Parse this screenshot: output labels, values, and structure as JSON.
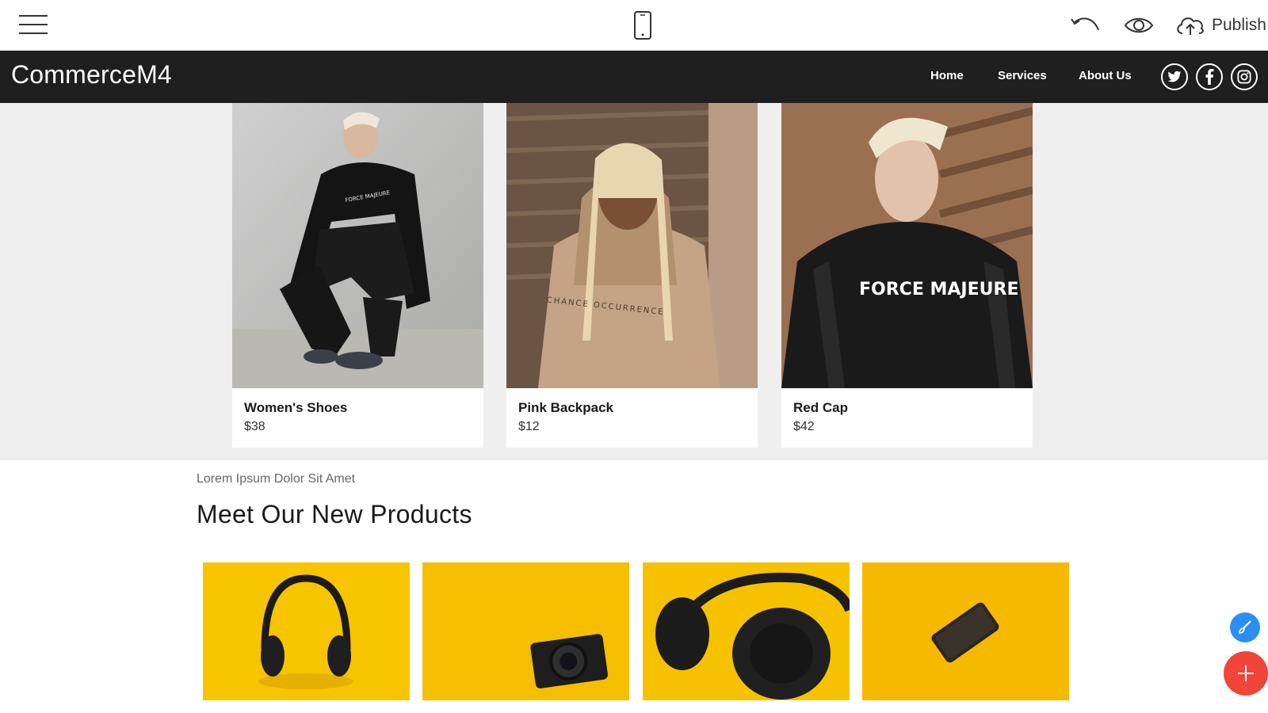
{
  "editor": {
    "menu_icon": "hamburger-icon",
    "device_icon": "mobile-phone-icon",
    "undo_icon": "undo-icon",
    "preview_icon": "eye-icon",
    "publish_icon": "cloud-upload-icon",
    "publish_label": "Publish"
  },
  "site": {
    "brand": "CommerceM4",
    "nav": [
      "Home",
      "Services",
      "About Us"
    ],
    "social": [
      "twitter-icon",
      "facebook-icon",
      "instagram-icon"
    ]
  },
  "featured": {
    "cards": [
      {
        "name": "Women's Shoes",
        "price": "$38"
      },
      {
        "name": "Pink Backpack",
        "price": "$12"
      },
      {
        "name": "Red Cap",
        "price": "$42"
      }
    ],
    "shirt_texts": [
      "FORCE MAJEURE",
      "CHANCE OCCURRENCE",
      "FORCE MAJEURE"
    ]
  },
  "new_products": {
    "eyebrow": "Lorem Ipsum Dolor Sit Amet",
    "title": "Meet Our New Products",
    "items": [
      "headphones-image",
      "camera-image",
      "headphones-closeup-image",
      "smartphone-image"
    ]
  },
  "colors": {
    "nav_bg": "#1f1f1f",
    "section_bg": "#efefef",
    "product_yellow": "#f7c400",
    "fab_blue": "#2a8ff0",
    "fab_red": "#f0453b"
  },
  "floating": {
    "style_icon": "brush-icon",
    "add_icon": "plus-icon"
  }
}
